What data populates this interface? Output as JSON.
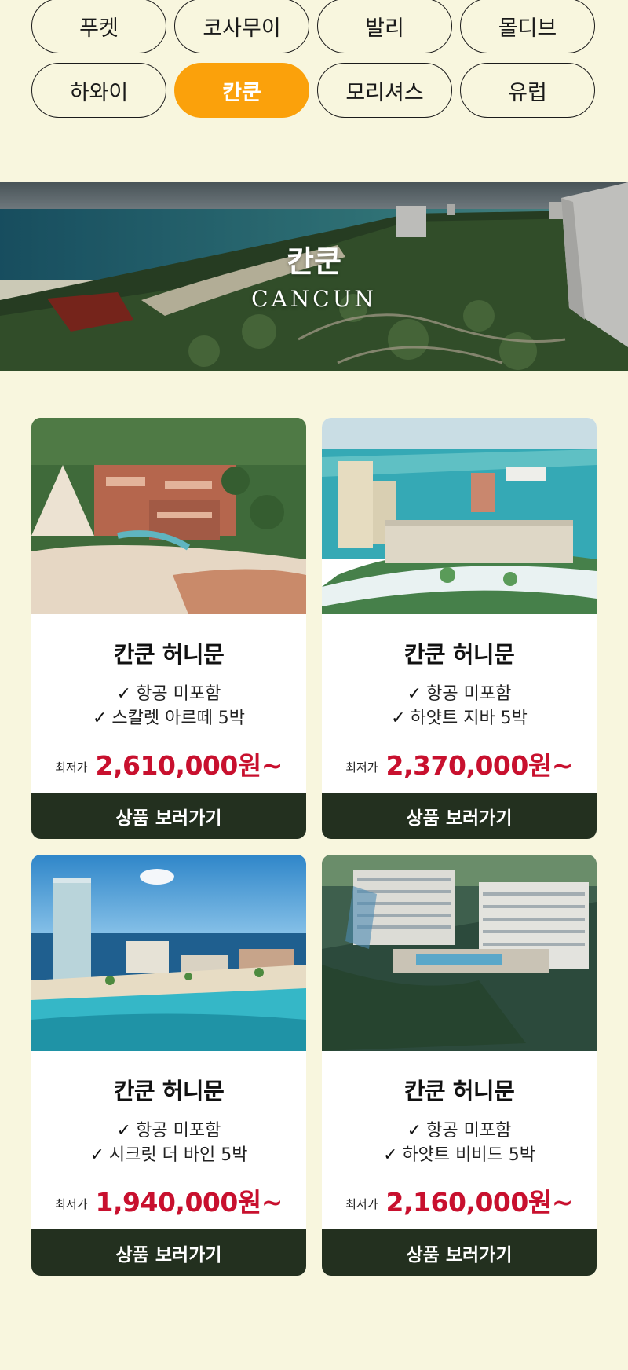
{
  "destinations": [
    {
      "label": "푸켓",
      "active": false
    },
    {
      "label": "코사무이",
      "active": false
    },
    {
      "label": "발리",
      "active": false
    },
    {
      "label": "몰디브",
      "active": false
    },
    {
      "label": "하와이",
      "active": false
    },
    {
      "label": "칸쿤",
      "active": true
    },
    {
      "label": "모리셔스",
      "active": false
    },
    {
      "label": "유럽",
      "active": false
    }
  ],
  "colors": {
    "accent": "#fba10b",
    "background": "#f8f6de",
    "price": "#c8102e",
    "button": "#23301f"
  },
  "banner": {
    "title": "칸쿤",
    "subtitle": "CANCUN"
  },
  "products": [
    {
      "title": "칸쿤 허니문",
      "features": [
        "항공 미포함",
        "스칼렛 아르떼 5박"
      ],
      "price_label": "최저가",
      "price": "2,610,000원~",
      "button": "상품 보러가기"
    },
    {
      "title": "칸쿤 허니문",
      "features": [
        "항공 미포함",
        "하얏트 지바 5박"
      ],
      "price_label": "최저가",
      "price": "2,370,000원~",
      "button": "상품 보러가기"
    },
    {
      "title": "칸쿤 허니문",
      "features": [
        "항공 미포함",
        "시크릿 더 바인 5박"
      ],
      "price_label": "최저가",
      "price": "1,940,000원~",
      "button": "상품 보러가기"
    },
    {
      "title": "칸쿤 허니문",
      "features": [
        "항공 미포함",
        "하얏트 비비드 5박"
      ],
      "price_label": "최저가",
      "price": "2,160,000원~",
      "button": "상품 보러가기"
    }
  ]
}
